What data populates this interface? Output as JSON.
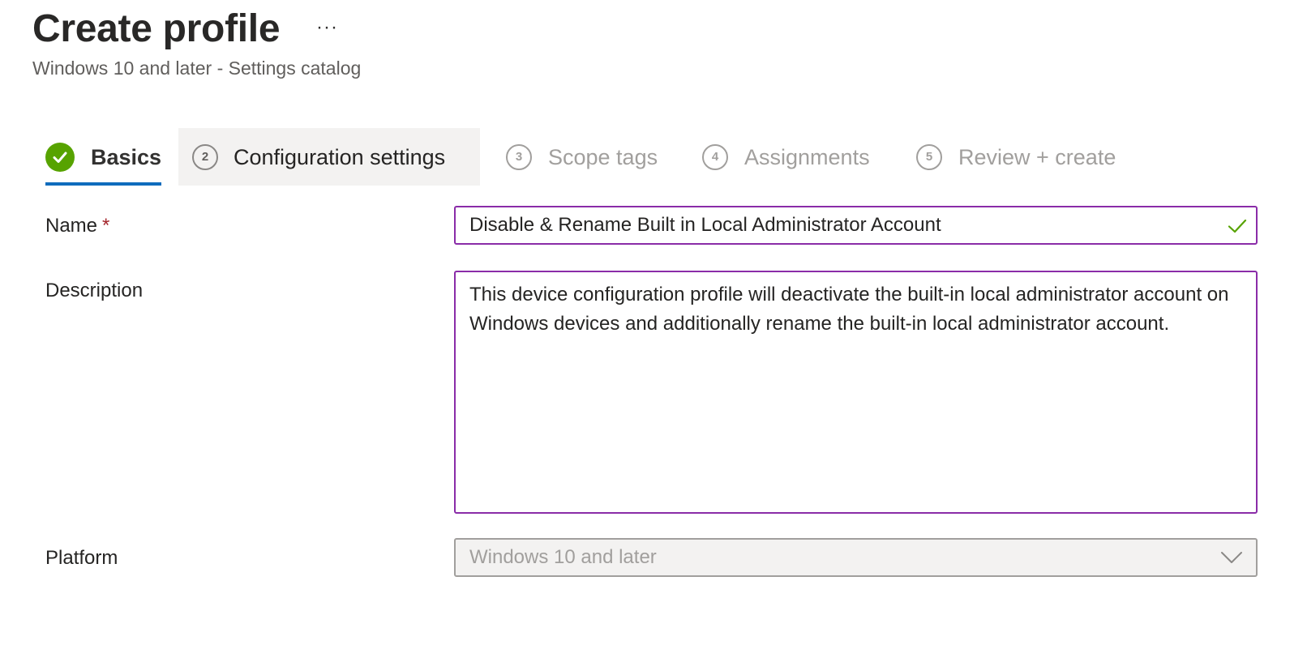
{
  "header": {
    "title": "Create profile",
    "more_label": "···",
    "subtitle": "Windows 10 and later - Settings catalog"
  },
  "wizard": {
    "steps": [
      {
        "number": "",
        "label": "Basics",
        "state": "completed"
      },
      {
        "number": "2",
        "label": "Configuration settings",
        "state": "current"
      },
      {
        "number": "3",
        "label": "Scope tags",
        "state": "upcoming"
      },
      {
        "number": "4",
        "label": "Assignments",
        "state": "upcoming"
      },
      {
        "number": "5",
        "label": "Review + create",
        "state": "upcoming"
      }
    ]
  },
  "form": {
    "name": {
      "label": "Name",
      "required_marker": "*",
      "value": "Disable & Rename Built in Local Administrator Account",
      "status_icon": "checkmark-icon"
    },
    "description": {
      "label": "Description",
      "value": "This device configuration profile will deactivate the built-in local administrator account on Windows devices and additionally rename the built-in local administrator account."
    },
    "platform": {
      "label": "Platform",
      "value": "Windows 10 and later",
      "disabled": true
    }
  },
  "colors": {
    "focus_border": "#8a2ca8",
    "completed_green": "#57a300",
    "active_underline": "#0f6cbd",
    "required_red": "#a4262c"
  }
}
